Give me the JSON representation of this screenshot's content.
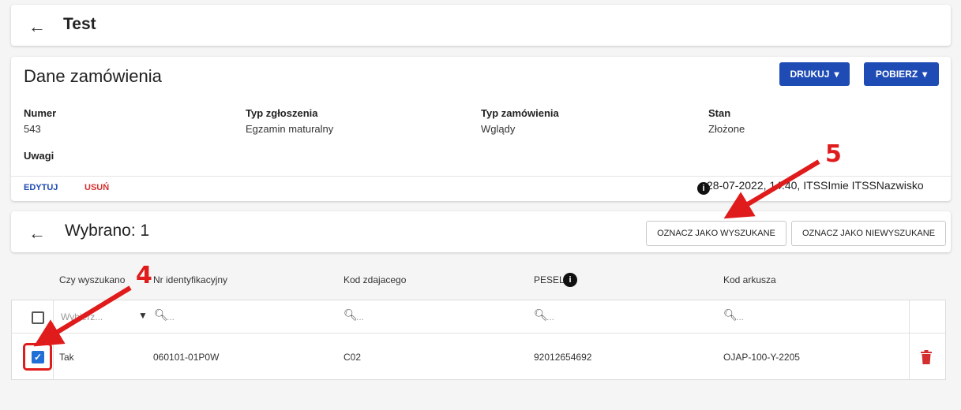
{
  "header": {
    "title": "Test"
  },
  "details": {
    "title": "Dane zamówienia",
    "buttons": {
      "print": "DRUKUJ",
      "download": "POBIERZ"
    },
    "fields": [
      {
        "label": "Numer",
        "value": "543"
      },
      {
        "label": "Typ zgłoszenia",
        "value": "Egzamin maturalny"
      },
      {
        "label": "Typ zamówienia",
        "value": "Wglądy"
      },
      {
        "label": "Stan",
        "value": "Złożone"
      }
    ],
    "notes_label": "Uwagi",
    "actions": {
      "edit": "EDYTUJ",
      "delete": "USUŃ"
    },
    "audit": "28-07-2022, 14:40, ITSSImie ITSSNazwisko"
  },
  "selection": {
    "title": "Wybrano: 1",
    "mark_found": "OZNACZ JAKO WYSZUKANE",
    "mark_not_found": "OZNACZ JAKO NIEWYSZUKANE"
  },
  "table": {
    "columns": [
      "Czy wyszukano",
      "Nr identyfikacyjny",
      "Kod zdajacego",
      "PESEL",
      "Kod arkusza"
    ],
    "filter": {
      "select_placeholder": "Wybierz...",
      "search_placeholder": "..."
    },
    "rows": [
      {
        "found": "Tak",
        "id": "060101-01P0W",
        "code": "C02",
        "pesel": "92012654692",
        "sheet": "OJAP-100-Y-2205",
        "checked": true
      }
    ]
  },
  "annotations": {
    "step4": "4",
    "step5": "5"
  },
  "colors": {
    "primary": "#1f4bb5",
    "danger": "#d32f2f",
    "annotation": "#e01b1b",
    "checkbox": "#1f6fd6"
  }
}
